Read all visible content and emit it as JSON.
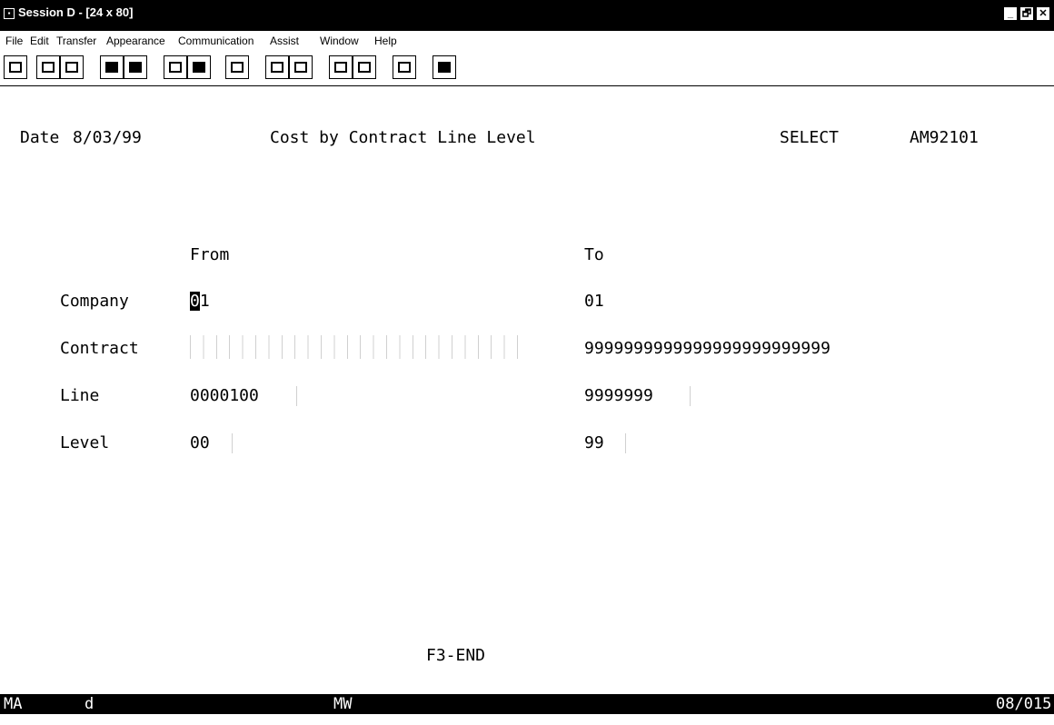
{
  "window": {
    "title": "Session D - [24 x 80]",
    "controls": [
      "minimize",
      "maximize",
      "close"
    ],
    "control_glyphs": {
      "minimize": "_",
      "maximize": "🗗",
      "close": "✕"
    }
  },
  "menu": {
    "items": [
      "File",
      "Edit",
      "Transfer",
      "Appearance",
      "Communication",
      "Assist",
      "Window",
      "Help"
    ]
  },
  "toolbar": {
    "icons": [
      "display-icon",
      "copy-icon",
      "paste-icon",
      "send-icon",
      "receive-icon",
      "keypad-icon",
      "screen-icon",
      "chart-icon",
      "macro-record-icon",
      "macro-stop-icon",
      "macro-play-icon",
      "macro-pause-icon",
      "clipboard-icon",
      "exit-icon"
    ]
  },
  "screen": {
    "date_label": "Date",
    "date_value": "8/03/99",
    "title": "Cost by Contract Line Level",
    "mode": "SELECT",
    "program_id": "AM92101",
    "from_header": "From",
    "to_header": "To",
    "rows": [
      {
        "label": "Company",
        "from": "01",
        "to": "01"
      },
      {
        "label": "Contract",
        "from": "",
        "to": "9999999999999999999999999"
      },
      {
        "label": "Line",
        "from": "0000100",
        "to": "9999999"
      },
      {
        "label": "Level",
        "from": "00",
        "to": "99"
      }
    ],
    "function_key": "F3-END"
  },
  "status": {
    "left": "MA",
    "indicator": "d",
    "center": "MW",
    "cursor_pos": "08/015"
  }
}
